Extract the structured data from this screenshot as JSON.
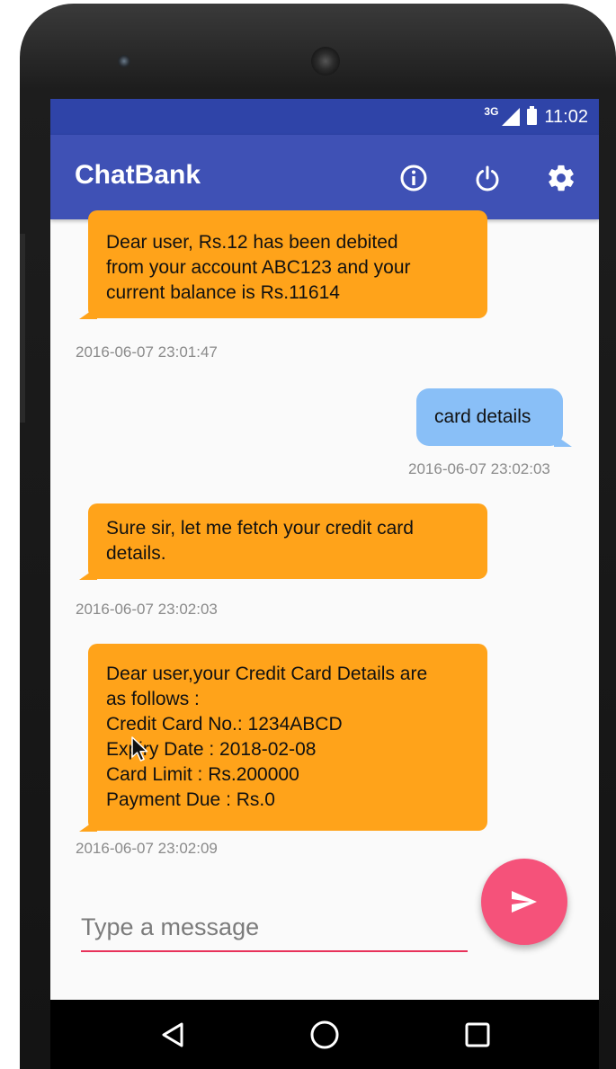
{
  "status_bar": {
    "network": "3G",
    "time": "11:02"
  },
  "app_bar": {
    "title": "ChatBank",
    "icons": [
      "info-icon",
      "power-icon",
      "settings-icon"
    ]
  },
  "messages": [
    {
      "side": "incoming",
      "lines": [
        "Dear user, Rs.12 has been debited",
        "from your account ABC123 and your",
        "current balance is Rs.11614"
      ],
      "timestamp": "2016-06-07 23:01:47"
    },
    {
      "side": "outgoing",
      "lines": [
        "card details"
      ],
      "timestamp": "2016-06-07 23:02:03"
    },
    {
      "side": "incoming",
      "lines": [
        "Sure sir, let me fetch your credit card",
        "details."
      ],
      "timestamp": "2016-06-07 23:02:03"
    },
    {
      "side": "incoming",
      "lines": [
        "Dear user,your Credit Card Details are",
        "as follows :",
        "Credit Card No.: 1234ABCD",
        "Expiry Date : 2018-02-08",
        "Card Limit : Rs.200000",
        "Payment Due : Rs.0"
      ],
      "timestamp": "2016-06-07 23:02:09"
    }
  ],
  "composer": {
    "placeholder": "Type a message",
    "value": ""
  },
  "colors": {
    "status_bar": "#2f44a8",
    "app_bar": "#3f51b5",
    "incoming_bubble": "#ffa31a",
    "outgoing_bubble": "#89bff7",
    "fab": "#f5527a",
    "input_underline": "#e8325a"
  },
  "nav_bar": {
    "icons": [
      "back-icon",
      "home-icon",
      "recents-icon"
    ]
  }
}
